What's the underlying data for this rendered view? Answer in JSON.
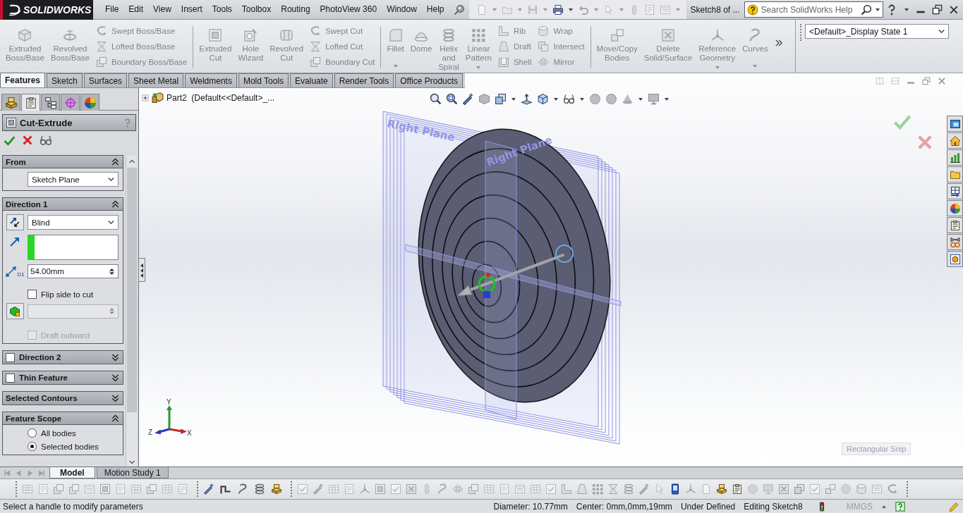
{
  "title_bar": {
    "logo": "SOLIDWORKS",
    "menu": [
      "File",
      "Edit",
      "View",
      "Insert",
      "Tools",
      "Toolbox",
      "Routing",
      "PhotoView 360",
      "Window",
      "Help"
    ],
    "document_title": "Sketch8 of ...",
    "search": {
      "placeholder": "Search SolidWorks Help"
    }
  },
  "ribbon": {
    "groups": [
      [
        {
          "label": "Extruded Boss/Base",
          "kind": "large",
          "disabled": true
        },
        {
          "label": "Revolved Boss/Base",
          "kind": "large",
          "disabled": true
        },
        {
          "label": "Swept Boss/Base",
          "kind": "small",
          "disabled": true
        },
        {
          "label": "Lofted Boss/Base",
          "kind": "small",
          "disabled": true
        },
        {
          "label": "Boundary Boss/Base",
          "kind": "small",
          "disabled": true
        }
      ],
      [
        {
          "label": "Extruded Cut",
          "kind": "large",
          "disabled": true
        },
        {
          "label": "Hole Wizard",
          "kind": "large",
          "disabled": true
        },
        {
          "label": "Revolved Cut",
          "kind": "large",
          "disabled": true
        },
        {
          "label": "Swept Cut",
          "kind": "small",
          "disabled": true
        },
        {
          "label": "Lofted Cut",
          "kind": "small",
          "disabled": true
        },
        {
          "label": "Boundary Cut",
          "kind": "small",
          "disabled": true
        }
      ],
      [
        {
          "label": "Fillet",
          "kind": "split",
          "disabled": true
        },
        {
          "label": "Dome",
          "kind": "large",
          "disabled": true
        },
        {
          "label": "Helix and Spiral",
          "kind": "large",
          "disabled": true
        },
        {
          "label": "Linear Pattern",
          "kind": "split",
          "disabled": true
        },
        {
          "label": "Rib",
          "kind": "small",
          "disabled": true
        },
        {
          "label": "Draft",
          "kind": "small",
          "disabled": true
        },
        {
          "label": "Shell",
          "kind": "small",
          "disabled": true
        },
        {
          "label": "Wrap",
          "kind": "small",
          "disabled": true
        },
        {
          "label": "Intersect",
          "kind": "small",
          "disabled": true
        },
        {
          "label": "Mirror",
          "kind": "small",
          "disabled": true
        }
      ],
      [
        {
          "label": "Move/Copy Bodies",
          "kind": "large",
          "disabled": true
        },
        {
          "label": "Delete Solid/Surface",
          "kind": "large",
          "disabled": true
        },
        {
          "label": "Reference Geometry",
          "kind": "split",
          "disabled": true
        },
        {
          "label": "Curves",
          "kind": "split",
          "disabled": true
        }
      ]
    ],
    "display_state": "<Default>_Display State 1"
  },
  "command_tabs": [
    {
      "label": "Features",
      "selected": true
    },
    {
      "label": "Sketch",
      "selected": false
    },
    {
      "label": "Surfaces",
      "selected": false
    },
    {
      "label": "Sheet Metal",
      "selected": false
    },
    {
      "label": "Weldments",
      "selected": false
    },
    {
      "label": "Mold Tools",
      "selected": false
    },
    {
      "label": "Evaluate",
      "selected": false
    },
    {
      "label": "Render Tools",
      "selected": false
    },
    {
      "label": "Office Products",
      "selected": false
    }
  ],
  "property_manager": {
    "tabs": [
      {
        "selected": false
      },
      {
        "selected": true
      },
      {
        "selected": false
      },
      {
        "selected": false
      },
      {
        "selected": false
      }
    ],
    "title": "Cut-Extrude",
    "groups": [
      {
        "title": "From",
        "kind": "plain",
        "expanded": true,
        "rows": [
          {
            "kind": "select",
            "value": "Sketch Plane"
          }
        ]
      },
      {
        "title": "Direction 1",
        "kind": "plain",
        "expanded": true,
        "rows": [
          {
            "kind": "select",
            "value": "Blind"
          },
          {
            "kind": "selection"
          },
          {
            "kind": "spin",
            "value": "54.00mm",
            "icon_label": "D1",
            "disabled": false
          },
          {
            "kind": "checkbox",
            "label": "Flip side to cut",
            "checked": false,
            "disabled": false
          },
          {
            "kind": "spin",
            "disabled": true
          },
          {
            "kind": "checkbox",
            "label": "Draft outward",
            "checked": false,
            "disabled": true
          }
        ]
      },
      {
        "title": "Direction 2",
        "kind": "check",
        "checked": false,
        "expanded": false
      },
      {
        "title": "Thin Feature",
        "kind": "check",
        "checked": false,
        "expanded": false
      },
      {
        "title": "Selected Contours",
        "kind": "plain",
        "expanded": false
      },
      {
        "title": "Feature Scope",
        "kind": "plain",
        "expanded": true,
        "rows": [
          {
            "kind": "radio",
            "label": "All bodies",
            "selected": false
          },
          {
            "kind": "radio",
            "label": "Selected bodies",
            "selected": true
          }
        ]
      }
    ]
  },
  "feature_tree": {
    "label": "Part2  (Default<<Default>_...",
    "expanded": false
  },
  "graphics": {
    "plane_labels": [
      "Right Plane",
      "Right Plane"
    ],
    "triad": {
      "x": "X",
      "y": "Y",
      "z": "Z"
    },
    "hint": "Rectangular Snip"
  },
  "bottom_tabs": [
    {
      "label": "Model",
      "selected": true
    },
    {
      "label": "Motion Study 1",
      "selected": false
    }
  ],
  "status_bar": {
    "message": "Select a handle to modify parameters",
    "fields": [
      "Diameter: 10.77mm",
      "Center: 0mm,0mm,19mm",
      "Under Defined",
      "Editing Sketch8"
    ],
    "units": "MMGS"
  }
}
